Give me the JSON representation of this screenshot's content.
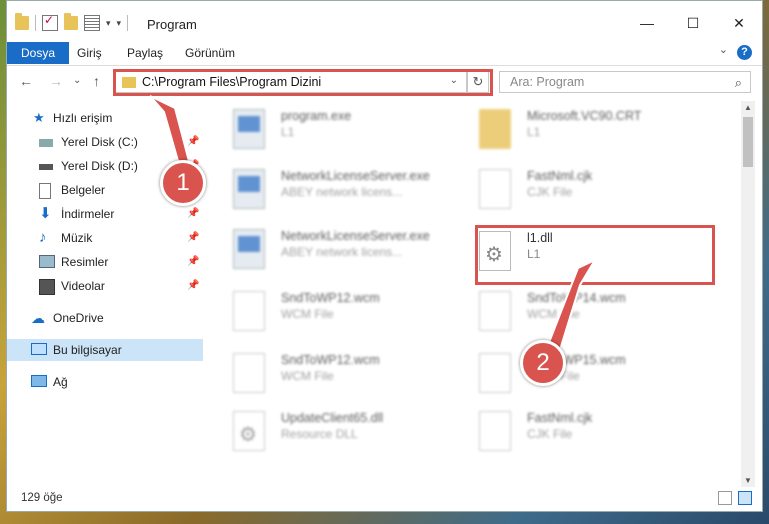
{
  "window": {
    "title": "Program",
    "controls": {
      "minimize": "—",
      "maximize": "☐",
      "close": "✕"
    }
  },
  "ribbon": {
    "tabs": [
      "Dosya",
      "Giriş",
      "Paylaş",
      "Görünüm"
    ],
    "help": "?"
  },
  "navigation": {
    "back": "←",
    "forward": "→",
    "recent": "⌄",
    "up": "↑",
    "address": "C:\\Program Files\\Program Dizini",
    "refresh": "↻",
    "search_placeholder": "Ara: Program"
  },
  "sidebar": {
    "items": [
      {
        "label": "Hızlı erişim",
        "icon": "star-icon",
        "pinned": false
      },
      {
        "label": "Yerel Disk (C:)",
        "icon": "drive-icon",
        "pinned": true
      },
      {
        "label": "Yerel Disk (D:)",
        "icon": "drive-icon",
        "pinned": true
      },
      {
        "label": "Belgeler",
        "icon": "documents-icon",
        "pinned": true
      },
      {
        "label": "İndirmeler",
        "icon": "downloads-icon",
        "pinned": true
      },
      {
        "label": "Müzik",
        "icon": "music-icon",
        "pinned": true
      },
      {
        "label": "Resimler",
        "icon": "pictures-icon",
        "pinned": true
      },
      {
        "label": "Videolar",
        "icon": "videos-icon",
        "pinned": true
      },
      {
        "label": "OneDrive",
        "icon": "cloud-icon",
        "pinned": false
      },
      {
        "label": "Bu bilgisayar",
        "icon": "computer-icon",
        "pinned": false
      },
      {
        "label": "Ağ",
        "icon": "network-icon",
        "pinned": false
      }
    ],
    "pin_glyph": "📌"
  },
  "files": [
    {
      "name": "program.exe",
      "sub": "L1",
      "icon": "app-icon"
    },
    {
      "name": "Microsoft.VC90.CRT",
      "sub": "L1",
      "icon": "folder-icon"
    },
    {
      "name": "NetworkLicenseServer.exe",
      "sub": "ABEY network licens...",
      "icon": "app-icon"
    },
    {
      "name": "FastNml.cjk",
      "sub": "CJK File",
      "icon": "document-icon"
    },
    {
      "name": "NetworkLicenseServer.exe",
      "sub": "ABEY network licens...",
      "icon": "app-icon"
    },
    {
      "name": "l1.dll",
      "sub": "L1",
      "icon": "dll-gear-icon"
    },
    {
      "name": "SndToWP12.wcm",
      "sub": "WCM File",
      "icon": "document-icon"
    },
    {
      "name": "SndToWP14.wcm",
      "sub": "WCM File",
      "icon": "document-icon"
    },
    {
      "name": "SndToWP12.wcm",
      "sub": "WCM File",
      "icon": "document-icon"
    },
    {
      "name": "SndToWP15.wcm",
      "sub": "WCM File",
      "icon": "document-icon"
    },
    {
      "name": "UpdateClient65.dll",
      "sub": "Resource DLL",
      "icon": "dll-gear-icon"
    },
    {
      "name": "FastNml.cjk",
      "sub": "CJK File",
      "icon": "document-icon"
    }
  ],
  "status": {
    "count": "129 öğe"
  },
  "callouts": {
    "step1": "1",
    "step2": "2"
  },
  "colors": {
    "accent": "#1a6dc7",
    "highlight": "#d9534f",
    "selection": "#cce4f7"
  }
}
